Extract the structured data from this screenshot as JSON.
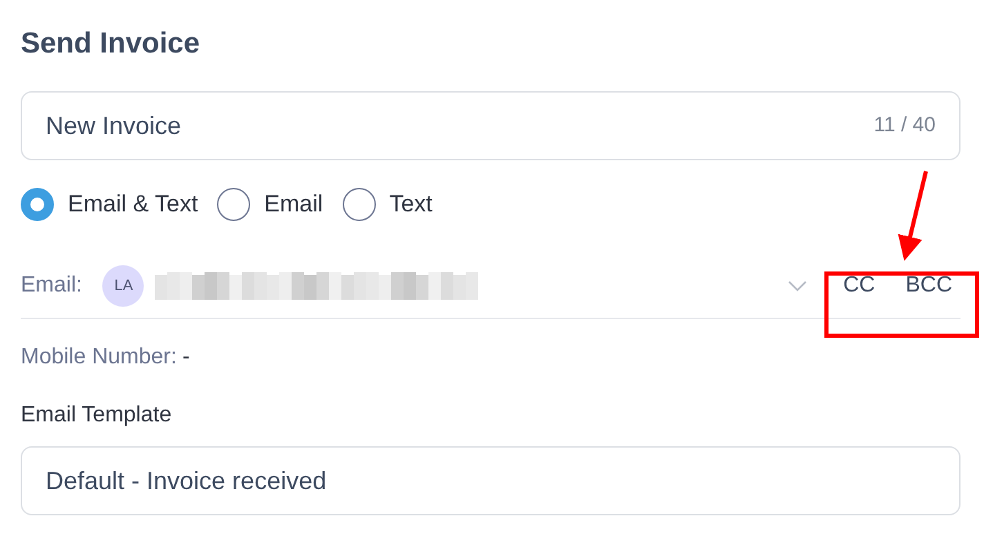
{
  "title": "Send Invoice",
  "subject": {
    "value": "New Invoice",
    "counter": "11 / 40"
  },
  "delivery_options": [
    {
      "label": "Email & Text",
      "selected": true
    },
    {
      "label": "Email",
      "selected": false
    },
    {
      "label": "Text",
      "selected": false
    }
  ],
  "email": {
    "label": "Email:",
    "avatar": "LA",
    "cc": "CC",
    "bcc": "BCC"
  },
  "mobile": {
    "label": "Mobile Number:",
    "value": "-"
  },
  "email_template": {
    "label": "Email Template",
    "value": "Default - Invoice received"
  }
}
